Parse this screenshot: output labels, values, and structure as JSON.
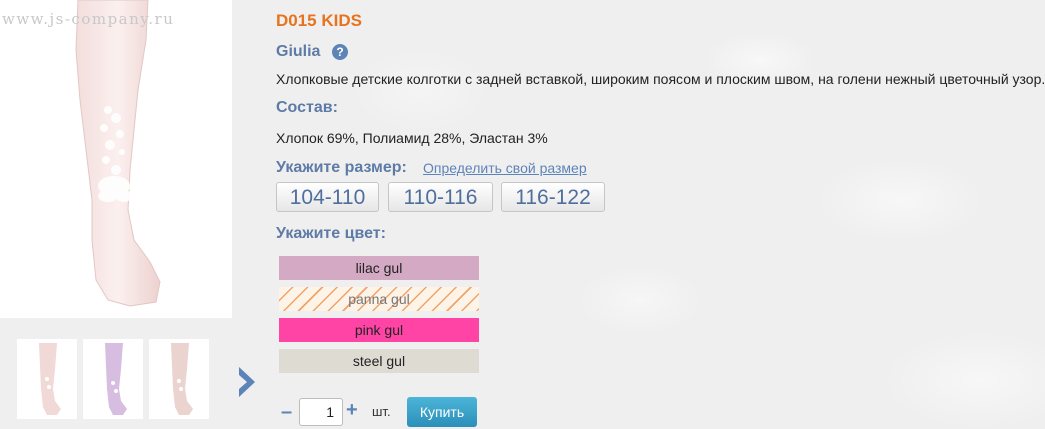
{
  "product": {
    "watermark": "www.js-company.ru",
    "title": "D015 KIDS",
    "model": "Giulia",
    "help_icon": "?",
    "description": "Хлопковые детские колготки с задней вставкой, широким поясом и плоским швом, на голени нежный цветочный узор."
  },
  "composition": {
    "label": "Состав:",
    "value": "Хлопок 69%, Полиамид 28%, Эластан 3%"
  },
  "size": {
    "label": "Укажите размер:",
    "link": "Определить свой размер",
    "options": [
      "104-110",
      "110-116",
      "116-122"
    ]
  },
  "color": {
    "label": "Укажите цвет:",
    "options": [
      {
        "name": "lilac gul",
        "color": "#d3a9c3",
        "available": true
      },
      {
        "name": "panna gul",
        "color": "#fdf3e6",
        "available": false
      },
      {
        "name": "pink gul",
        "color": "#ff44a6",
        "available": true
      },
      {
        "name": "steel gul",
        "color": "#dddbd2",
        "available": true
      }
    ]
  },
  "cart": {
    "minus": "–",
    "quantity": "1",
    "plus": "+",
    "unit": "шт.",
    "buy_label": "Купить"
  },
  "icons": {
    "thumb_next": "chevron-right-icon",
    "help": "question-circle-icon"
  }
}
